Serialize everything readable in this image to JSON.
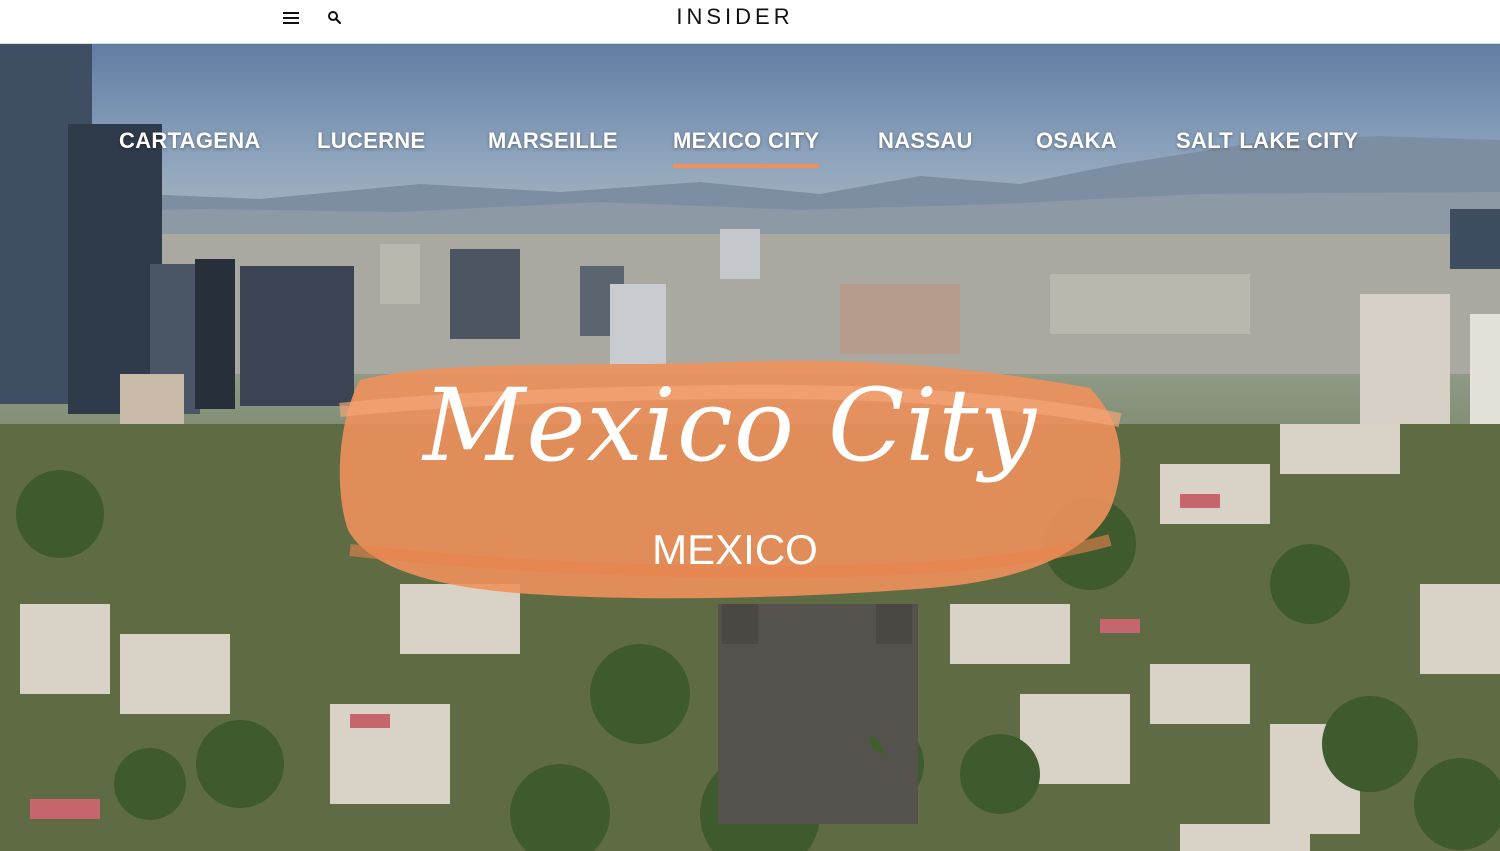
{
  "header": {
    "logo": "INSIDER",
    "menu_icon": "hamburger-menu-icon",
    "search_icon": "search-icon"
  },
  "nav": {
    "cities": [
      "CARTAGENA",
      "LUCERNE",
      "MARSEILLE",
      "MEXICO CITY",
      "NASSAU",
      "OSAKA",
      "SALT LAKE CITY"
    ],
    "active": "MEXICO CITY"
  },
  "hero": {
    "title": "Mexico City",
    "subtitle": "MEXICO",
    "accent_color": "#f0915c"
  }
}
